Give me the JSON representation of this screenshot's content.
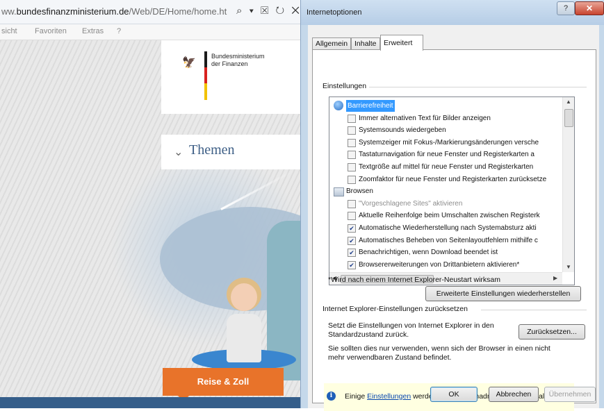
{
  "browser": {
    "url_prefix": "ww.",
    "url_domain": "bundesfinanzministerium.de",
    "url_path": "/Web/DE/Home/home.ht",
    "toolbar_glyphs": "⌕ ▾ ☒ ↻ ✕",
    "menu": [
      "sicht",
      "Favoriten",
      "Extras",
      "?"
    ],
    "ministry_line1": "Bundesministerium",
    "ministry_line2": "der Finanzen",
    "themen_label": "Themen",
    "reise_button": "Reise & Zoll"
  },
  "dialog": {
    "title": "Internetoptionen",
    "help_label": "?",
    "close_label": "✕",
    "tabs": [
      "Allgemein",
      "Inhalte",
      "Erweitert"
    ],
    "active_tab": "Erweitert",
    "settings_group_label": "Einstellungen",
    "settings": [
      {
        "kind": "category",
        "label": "Barrierefreiheit",
        "selected": true
      },
      {
        "kind": "option",
        "label": "Immer alternativen Text für Bilder anzeigen",
        "checked": false
      },
      {
        "kind": "option",
        "label": "Systemsounds wiedergeben",
        "checked": false
      },
      {
        "kind": "option",
        "label": "Systemzeiger mit Fokus-/Markierungsänderungen versche",
        "checked": false
      },
      {
        "kind": "option",
        "label": "Tastaturnavigation für neue Fenster und Registerkarten a",
        "checked": false
      },
      {
        "kind": "option",
        "label": "Textgröße auf mittel für neue Fenster und Registerkarten",
        "checked": false
      },
      {
        "kind": "option",
        "label": "Zoomfaktor für neue Fenster und Registerkarten zurücksetze",
        "checked": false
      },
      {
        "kind": "category",
        "label": "Browsen",
        "selected": false
      },
      {
        "kind": "option",
        "label": "\"Vorgeschlagene Sites\" aktivieren",
        "checked": false,
        "disabled": true
      },
      {
        "kind": "option",
        "label": "Aktuelle Reihenfolge beim Umschalten zwischen Registerk",
        "checked": false
      },
      {
        "kind": "option",
        "label": "Automatische Wiederherstellung nach Systemabsturz akti",
        "checked": true
      },
      {
        "kind": "option",
        "label": "Automatisches Beheben von Seitenlayoutfehlern mithilfe c",
        "checked": true
      },
      {
        "kind": "option",
        "label": "Benachrichtigen, wenn Download beendet ist",
        "checked": true
      },
      {
        "kind": "option",
        "label": "Browsererweiterungen von Drittanbietern aktivieren*",
        "checked": true
      }
    ],
    "restart_note": "*Wird nach einem Internet Explorer-Neustart wirksam",
    "restore_button": "Erweiterte Einstellungen wiederherstellen",
    "reset_group_label": "Internet Explorer-Einstellungen zurücksetzen",
    "reset_text_line1": "Setzt die Einstellungen von Internet Explorer in den",
    "reset_text_line2": "Standardzustand zurück.",
    "reset_button": "Zurücksetzen...",
    "reset_warning_line1": "Sie sollten dies nur verwenden, wenn sich der Browser in einen nicht",
    "reset_warning_line2": "mehr verwendbaren Zustand befindet.",
    "info_before": "Einige ",
    "info_link": "Einstellungen",
    "info_after": " werden vom Systemadministrator verwaltet.",
    "ok_button": "OK",
    "cancel_button": "Abbrechen",
    "apply_button": "Übernehmen"
  }
}
